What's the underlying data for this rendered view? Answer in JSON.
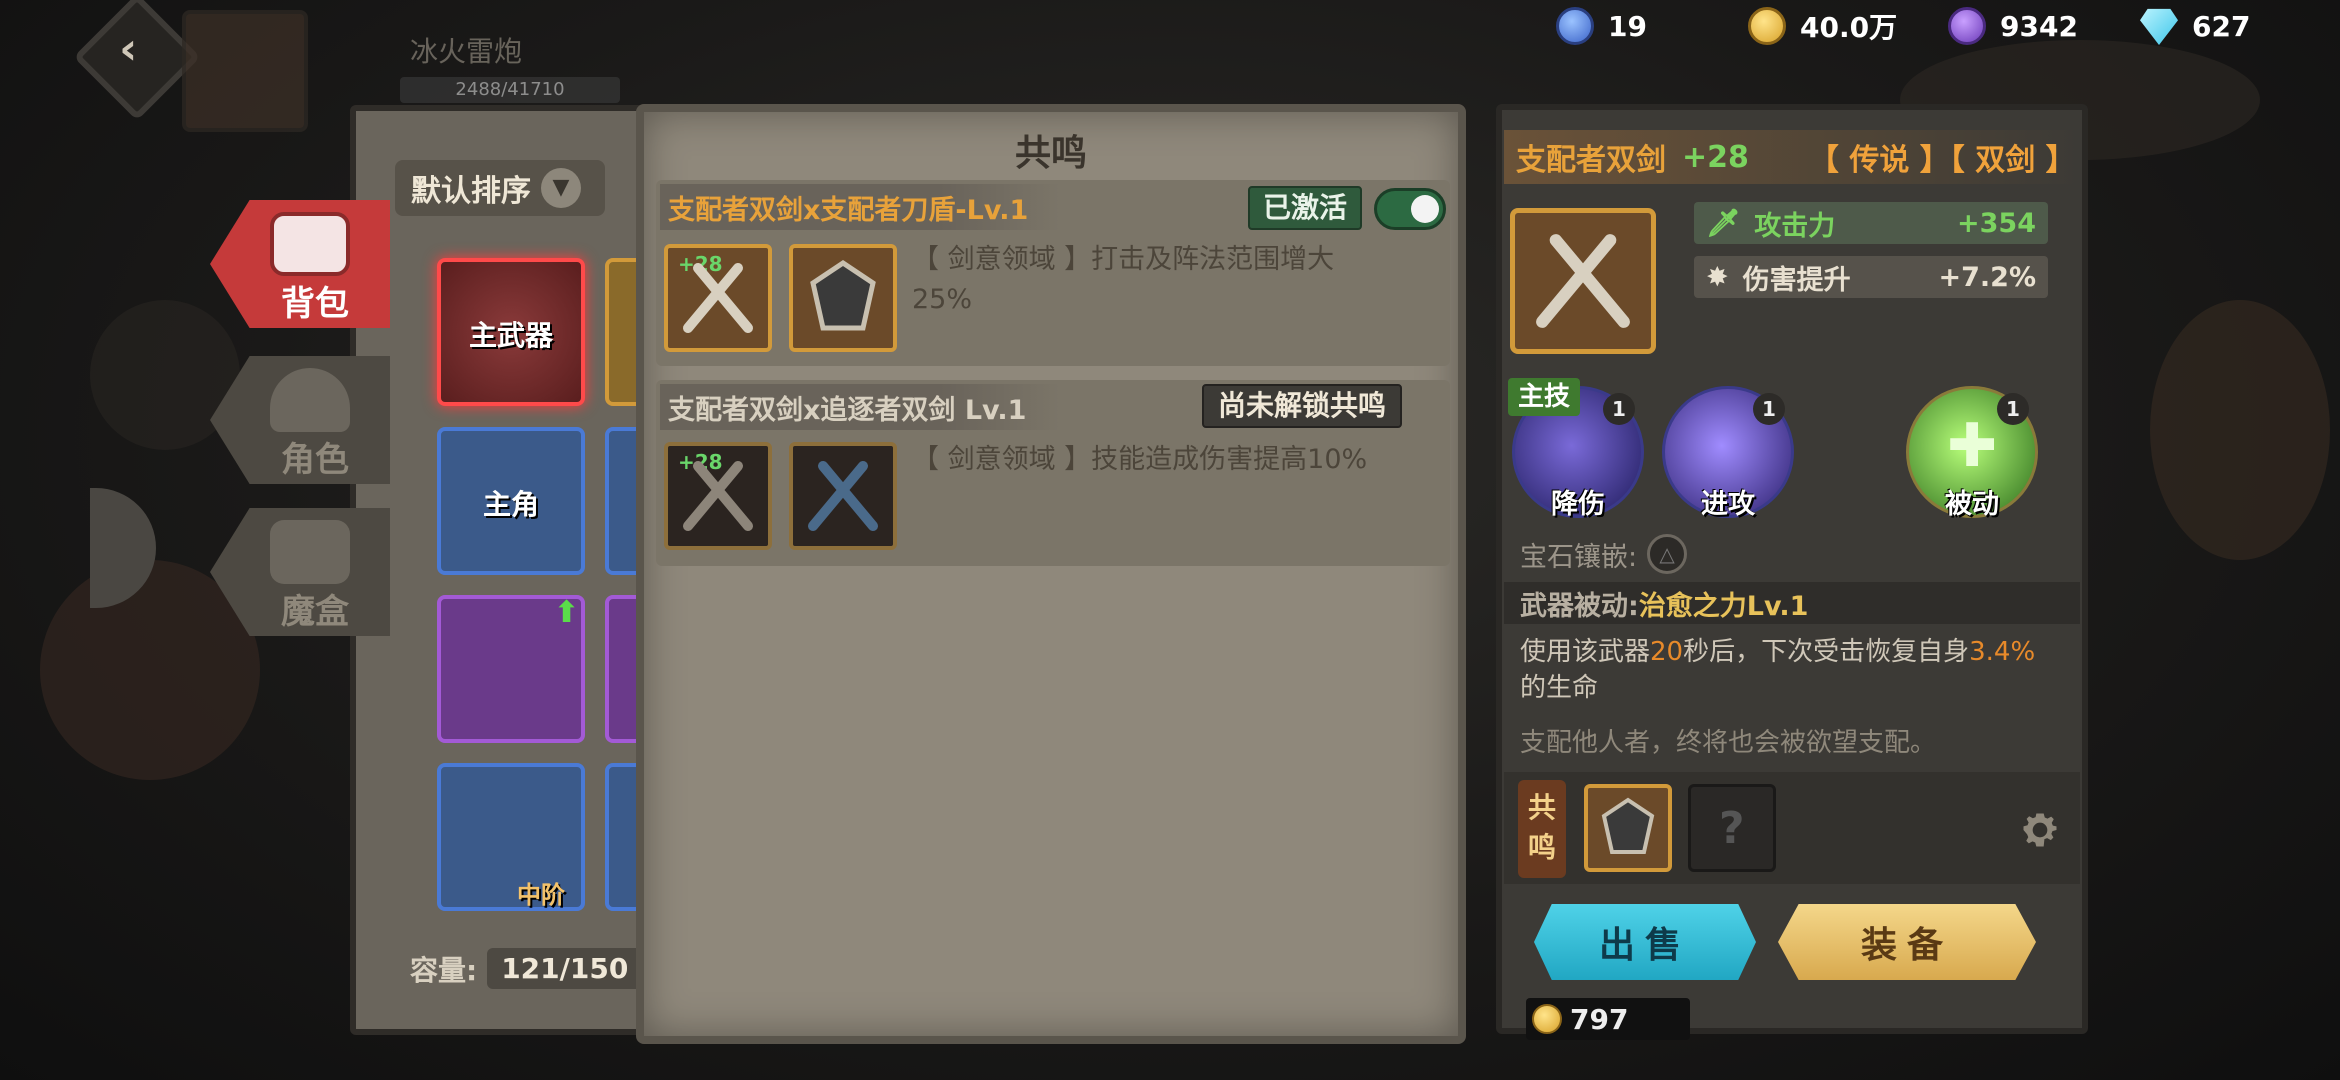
{
  "guild": {
    "name": "冰火雷炮",
    "progress_text": "2488/41710"
  },
  "currency": [
    {
      "name": "spirit-orb",
      "value": "19",
      "color": "#4f7fe0"
    },
    {
      "name": "gold",
      "value": "40.0万",
      "color": "#e6b52e"
    },
    {
      "name": "crystal",
      "value": "9342",
      "color": "#8a5ad6"
    },
    {
      "name": "diamond",
      "value": "627",
      "color": "#5ad1f0"
    }
  ],
  "tabs": [
    {
      "label": "背包",
      "active": true
    },
    {
      "label": "角色",
      "active": false
    },
    {
      "label": "魔盒",
      "active": false
    }
  ],
  "inventory": {
    "sort_label": "默认排序",
    "slots": [
      {
        "label": "主武器",
        "rarity": "legendary"
      },
      {
        "label": "主角",
        "rarity": "epic"
      },
      {
        "label": "",
        "rarity": "epic"
      },
      {
        "label": "中阶",
        "rarity": "rare"
      }
    ],
    "capacity_label": "容量:",
    "capacity_value": "121/150"
  },
  "resonance": {
    "title": "共鸣",
    "entries": [
      {
        "header": "支配者双剑x支配者刀盾-Lv.1",
        "status": "已激活",
        "enabled": true,
        "plus": "+28",
        "desc_line1": "【 剑意领域 】打击及阵法范围增大",
        "desc_line2": "25%"
      },
      {
        "header": "支配者双剑x追逐者双剑 Lv.1",
        "status": "尚未解锁共鸣",
        "plus": "+28",
        "desc_line1": "【 剑意领域 】技能造成伤害提高10%"
      }
    ]
  },
  "detail": {
    "name": "支配者双剑",
    "plus": "+28",
    "rarity": "【 传说 】【 双剑 】",
    "stats": [
      {
        "label": "攻击力",
        "value": "+354",
        "icon": "sword-icon"
      },
      {
        "label": "伤害提升",
        "value": "+7.2%",
        "icon": "burst-icon"
      }
    ],
    "main_skill_tag": "主技",
    "skills": [
      {
        "label": "降伤",
        "count": "1"
      },
      {
        "label": "进攻",
        "count": "1"
      },
      {
        "label": "被动",
        "count": "1"
      }
    ],
    "gem_label": "宝石镶嵌:",
    "passive_label": "武器被动:",
    "passive_name": "治愈之力Lv.1",
    "passive_desc_a": "使用该武器",
    "passive_desc_b": "20",
    "passive_desc_c": "秒后，下次受击恢复自身",
    "passive_desc_d": "3.4%",
    "passive_desc_e": "的生命",
    "flavor": "支配他人者，终将也会被欲望支配。",
    "resonance_tag": "共鸣",
    "sell_label": "出售",
    "equip_label": "装备",
    "price": "797"
  },
  "colors": {
    "accent_orange": "#e8a23a",
    "accent_green": "#7bd35f",
    "sell_blue": "#21a7c3",
    "equip_gold": "#d8a94e"
  }
}
